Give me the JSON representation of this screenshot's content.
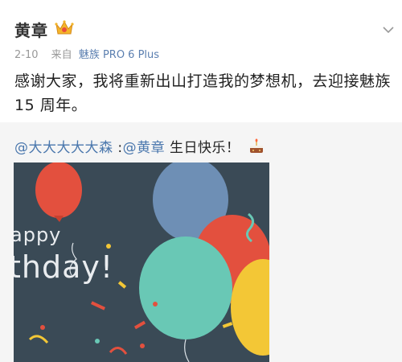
{
  "post": {
    "author": "黄章",
    "date": "2-10",
    "source_prefix": "来自",
    "device": "魅族 PRO 6 Plus",
    "text": "感谢大家，我将重新出山打造我的梦想机，去迎接魅族 15 周年。"
  },
  "repost": {
    "mention1": "@大大大大大森",
    "separator": " :",
    "mention2": "@黄章",
    "message": " 生日快乐！",
    "image_text_line1": "appy",
    "image_text_line2": "thday!"
  },
  "icons": {
    "verified": "crown-badge-icon",
    "menu": "chevron-down-icon",
    "emoji": "birthday-cake-icon"
  },
  "colors": {
    "mention": "#4a77ad",
    "device": "#5b7fb0",
    "card_bg": "#3a4a56"
  }
}
